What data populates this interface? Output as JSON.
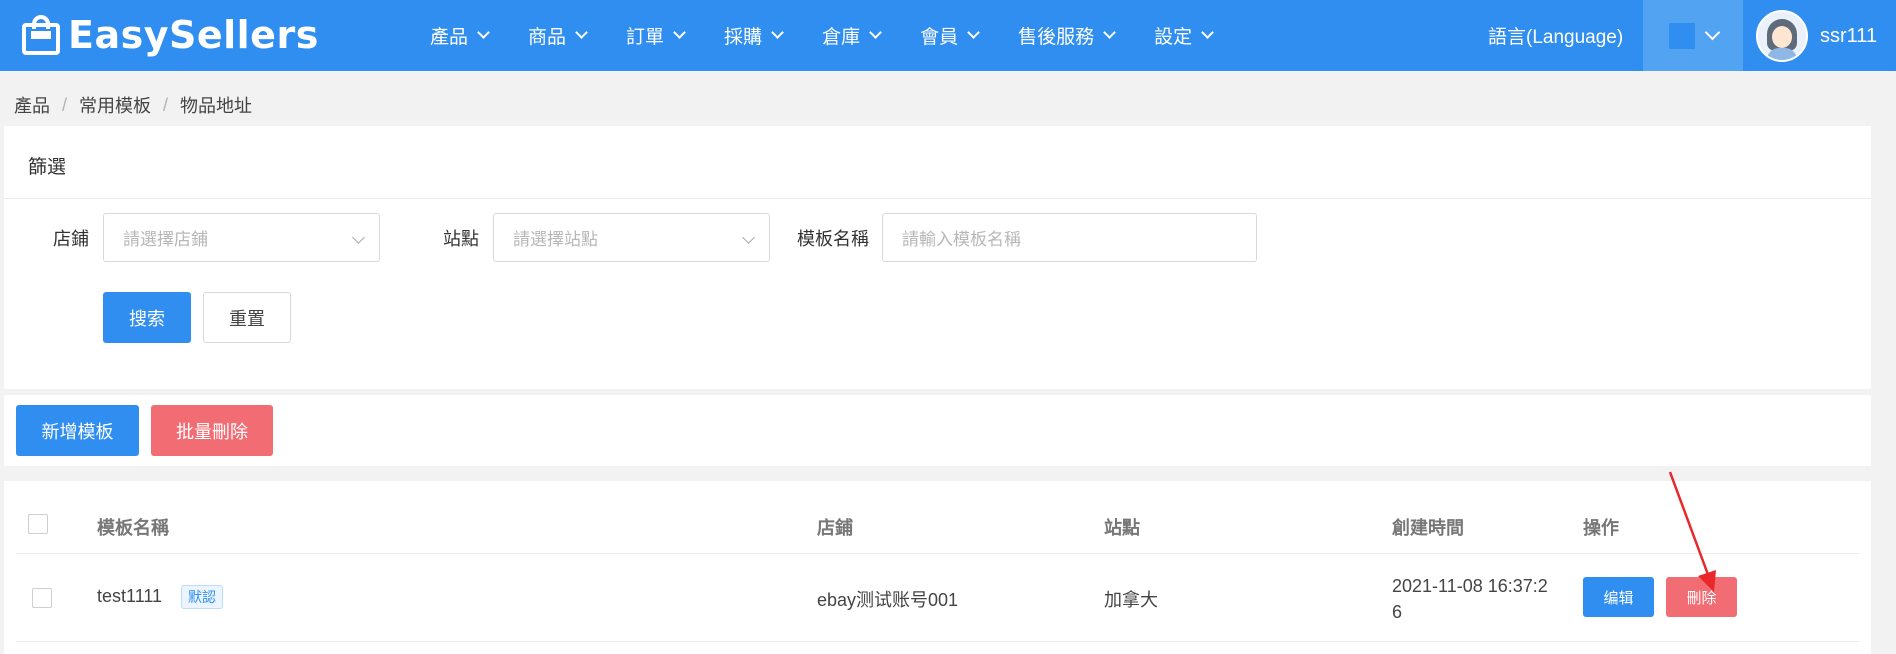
{
  "brand": {
    "logo_text": "EasySellers"
  },
  "nav": {
    "items": [
      {
        "label": "產品"
      },
      {
        "label": "商品"
      },
      {
        "label": "訂單"
      },
      {
        "label": "採購"
      },
      {
        "label": "倉庫"
      },
      {
        "label": "會員"
      },
      {
        "label": "售後服務"
      },
      {
        "label": "設定"
      }
    ],
    "language_label": "語言(Language)",
    "theme_color": "#2f8ef0",
    "username": "ssr111"
  },
  "breadcrumb": [
    "產品",
    "常用模板",
    "物品地址"
  ],
  "filter": {
    "title": "篩選",
    "store_label": "店鋪",
    "store_placeholder": "請選擇店鋪",
    "site_label": "站點",
    "site_placeholder": "請選擇站點",
    "template_label": "模板名稱",
    "template_placeholder": "請輸入模板名稱",
    "search_button": "搜索",
    "reset_button": "重置"
  },
  "actions": {
    "add_button": "新增模板",
    "batch_delete_button": "批量刪除"
  },
  "table": {
    "headers": {
      "name": "模板名稱",
      "store": "店鋪",
      "site": "站點",
      "created": "創建時間",
      "operation": "操作"
    },
    "rows": [
      {
        "name": "test1111",
        "tag": "默認",
        "store": "ebay测试账号001",
        "site": "加拿大",
        "created_line1": "2021-11-08 16:37:2",
        "created_line2": "6",
        "edit_label": "编辑",
        "delete_label": "刪除"
      }
    ]
  },
  "colors": {
    "primary": "#2f8ef0",
    "danger": "#f26d73",
    "annotation_arrow": "#e8282b"
  }
}
